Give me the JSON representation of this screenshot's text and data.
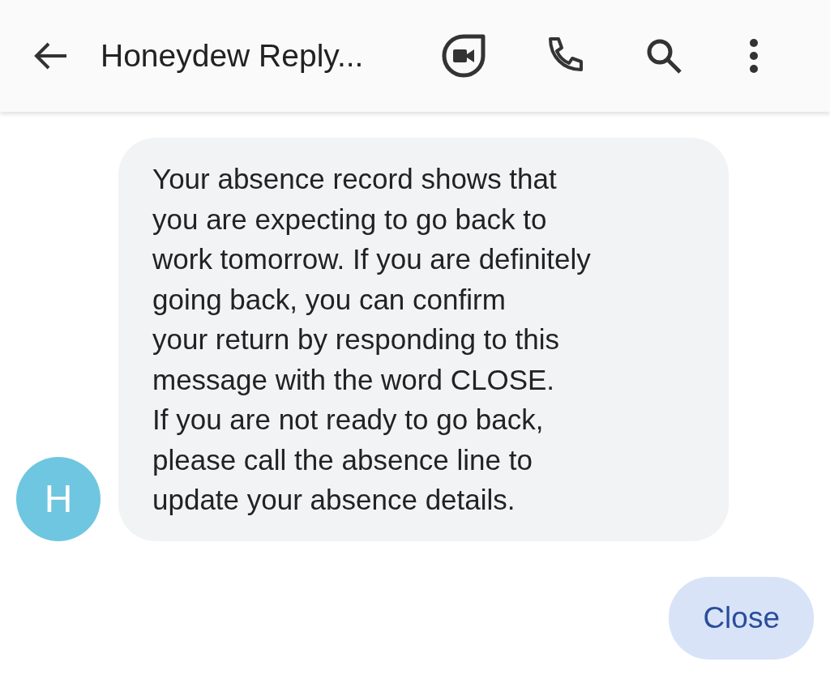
{
  "header": {
    "title": "Honeydew Reply..."
  },
  "messages": [
    {
      "kind": "received",
      "avatar": "H",
      "color": "#6ec6e0",
      "text": "Your absence record shows that\nyou are expecting to go back to\nwork tomorrow. If you are definitely\ngoing back, you can confirm\nyour return by responding to this\nmessage with the word CLOSE.\nIf you are not ready to go back,\nplease call the absence line to\nupdate your absence details."
    },
    {
      "kind": "sent",
      "text": "Close"
    }
  ]
}
